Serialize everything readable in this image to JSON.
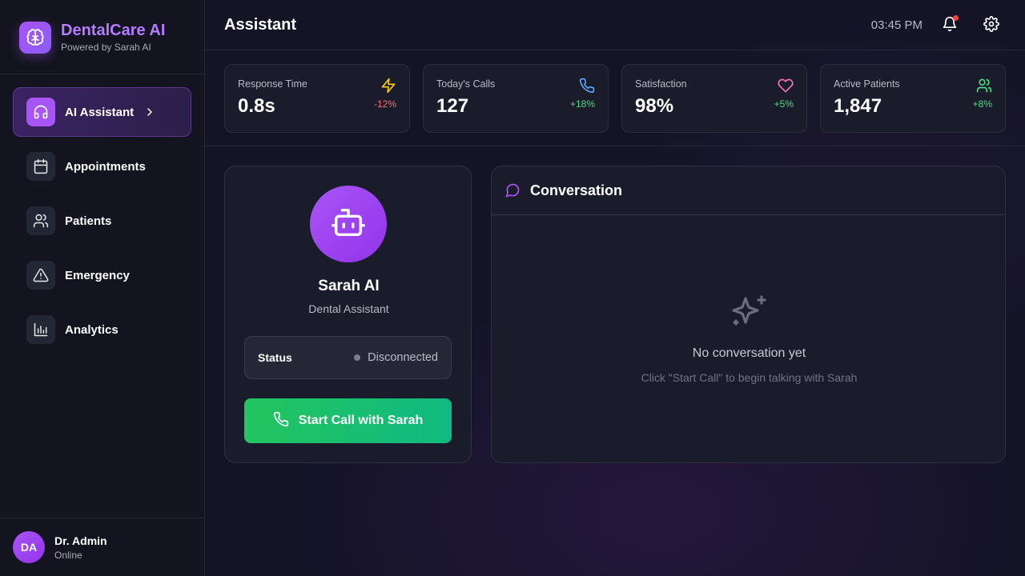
{
  "brand": {
    "title": "DentalCare AI",
    "subtitle": "Powered by Sarah AI"
  },
  "sidebar": {
    "items": [
      {
        "label": "AI Assistant",
        "icon": "headphones-icon",
        "active": true
      },
      {
        "label": "Appointments",
        "icon": "calendar-icon"
      },
      {
        "label": "Patients",
        "icon": "users-icon"
      },
      {
        "label": "Emergency",
        "icon": "warning-triangle-icon"
      },
      {
        "label": "Analytics",
        "icon": "bar-chart-icon"
      }
    ]
  },
  "user": {
    "initials": "DA",
    "name": "Dr. Admin",
    "status": "Online"
  },
  "header": {
    "title": "Assistant",
    "time": "03:45 PM"
  },
  "stats": [
    {
      "label": "Response Time",
      "value": "0.8s",
      "change": "-12%",
      "icon": "lightning-icon",
      "icon_color": "#facc15",
      "change_color": "#f87171"
    },
    {
      "label": "Today's Calls",
      "value": "127",
      "change": "+18%",
      "icon": "phone-icon",
      "icon_color": "#60a5fa",
      "change_color": "#4ade80"
    },
    {
      "label": "Satisfaction",
      "value": "98%",
      "change": "+5%",
      "icon": "heart-icon",
      "icon_color": "#f472b6",
      "change_color": "#4ade80"
    },
    {
      "label": "Active Patients",
      "value": "1,847",
      "change": "+8%",
      "icon": "users-icon",
      "icon_color": "#4ade80",
      "change_color": "#4ade80"
    }
  ],
  "assistant": {
    "name": "Sarah AI",
    "role": "Dental Assistant",
    "status_label": "Status",
    "status_value": "Disconnected",
    "call_button": "Start Call with Sarah"
  },
  "conversation": {
    "title": "Conversation",
    "empty_title": "No conversation yet",
    "empty_hint": "Click \"Start Call\" to begin talking with Sarah"
  },
  "colors": {
    "accent": "#a855f7",
    "success": "#22c55e",
    "notification": "#ef4444"
  }
}
